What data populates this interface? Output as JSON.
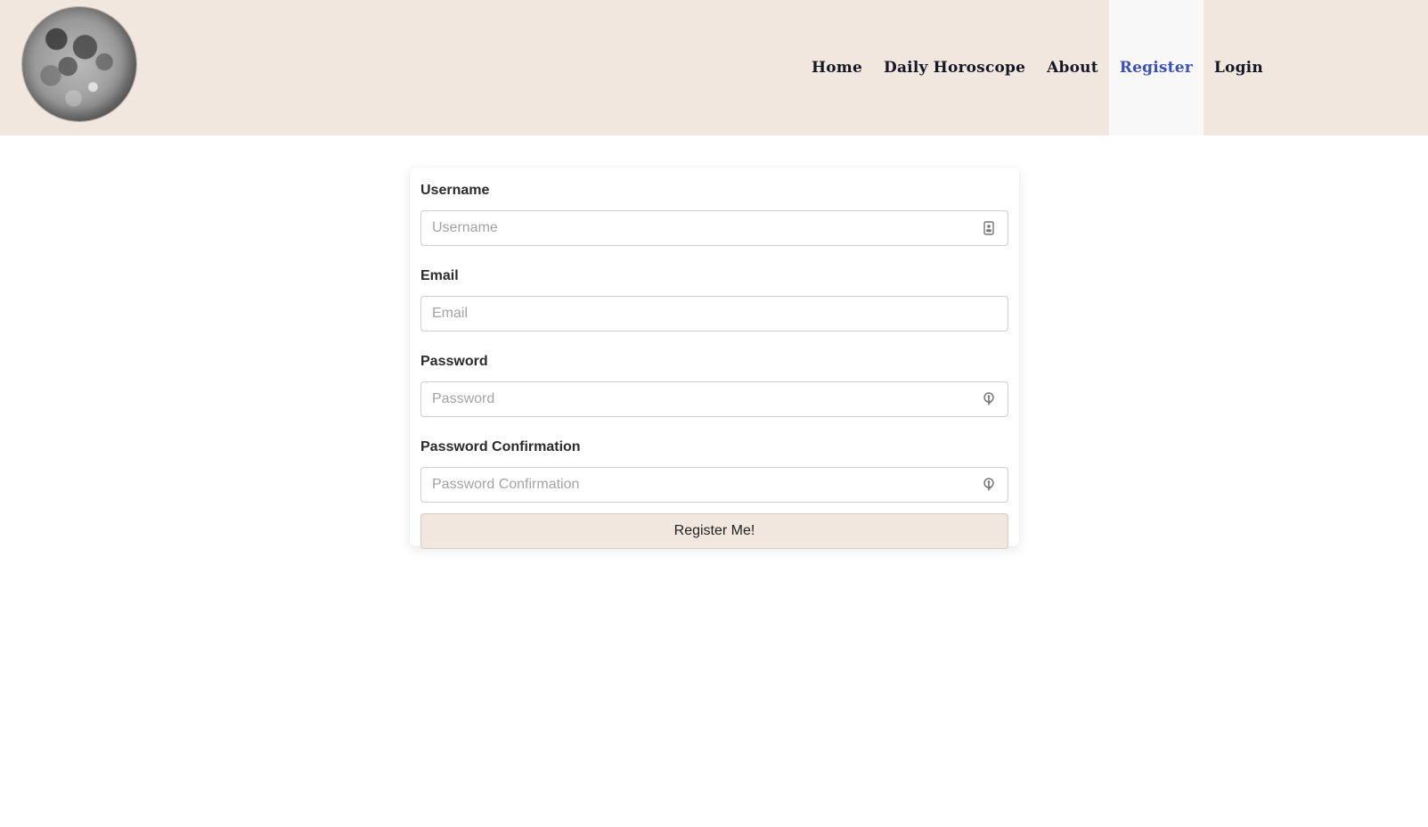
{
  "nav": {
    "items": [
      {
        "label": "Home"
      },
      {
        "label": "Daily Horoscope"
      },
      {
        "label": "About"
      },
      {
        "label": "Register"
      },
      {
        "label": "Login"
      }
    ],
    "active": "Register"
  },
  "form": {
    "username": {
      "label": "Username",
      "placeholder": "Username",
      "value": "",
      "icon": "contact-card-icon"
    },
    "email": {
      "label": "Email",
      "placeholder": "Email",
      "value": ""
    },
    "password": {
      "label": "Password",
      "placeholder": "Password",
      "value": "",
      "icon": "key-icon"
    },
    "password_confirmation": {
      "label": "Password Confirmation",
      "placeholder": "Password Confirmation",
      "value": "",
      "icon": "key-icon"
    },
    "submit_label": "Register Me!"
  },
  "colors": {
    "navbar_bg": "#f1e7df",
    "active_link": "#3a4fc0",
    "active_bg": "#f8f8f8",
    "button_bg": "#f1e7df"
  }
}
